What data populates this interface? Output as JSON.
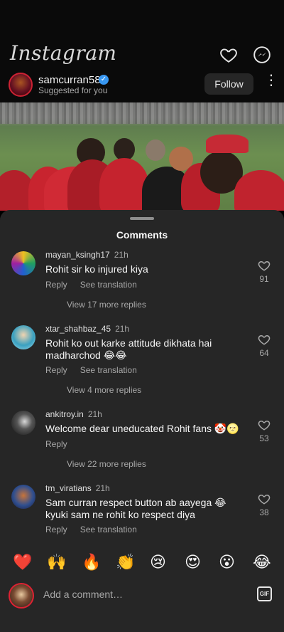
{
  "header": {
    "logo": "Instagram",
    "chevron": "⌄"
  },
  "post": {
    "username": "samcurran58",
    "verified_mark": "✓",
    "subtitle": "Suggested for you",
    "follow_label": "Follow",
    "more_label": "⋮"
  },
  "comments_sheet": {
    "title": "Comments",
    "comments": [
      {
        "user": "mayan_ksingh17",
        "time": "21h",
        "text": "Rohit sir ko injured kiya",
        "reply": "Reply",
        "translate": "See translation",
        "likes": "91",
        "more_replies": "View 17 more replies"
      },
      {
        "user": "xtar_shahbaz_45",
        "time": "21h",
        "text": "Rohit ko out karke attitude dikhata hai madharchod 😂😂",
        "reply": "Reply",
        "translate": "See translation",
        "likes": "64",
        "more_replies": "View 4 more replies"
      },
      {
        "user": "ankitroy.in",
        "time": "21h",
        "text": "Welcome dear uneducated Rohit fans 🤡🌝",
        "reply": "Reply",
        "likes": "53",
        "more_replies": "View 22 more replies"
      },
      {
        "user": "tm_viratians",
        "time": "21h",
        "text": "Sam curran respect button ab aayega 😂 kyuki sam ne rohit ko respect diya",
        "reply": "Reply",
        "translate": "See translation",
        "likes": "38"
      }
    ]
  },
  "emoji_bar": [
    "❤️",
    "🙌",
    "🔥",
    "👏",
    "😢",
    "😍",
    "😮",
    "😂"
  ],
  "composer": {
    "placeholder": "Add a comment…",
    "gif_label": "GIF"
  },
  "colors": {
    "sheet_bg": "#262626",
    "verified_blue": "#3897f0",
    "muted_text": "#a8a8a8"
  }
}
